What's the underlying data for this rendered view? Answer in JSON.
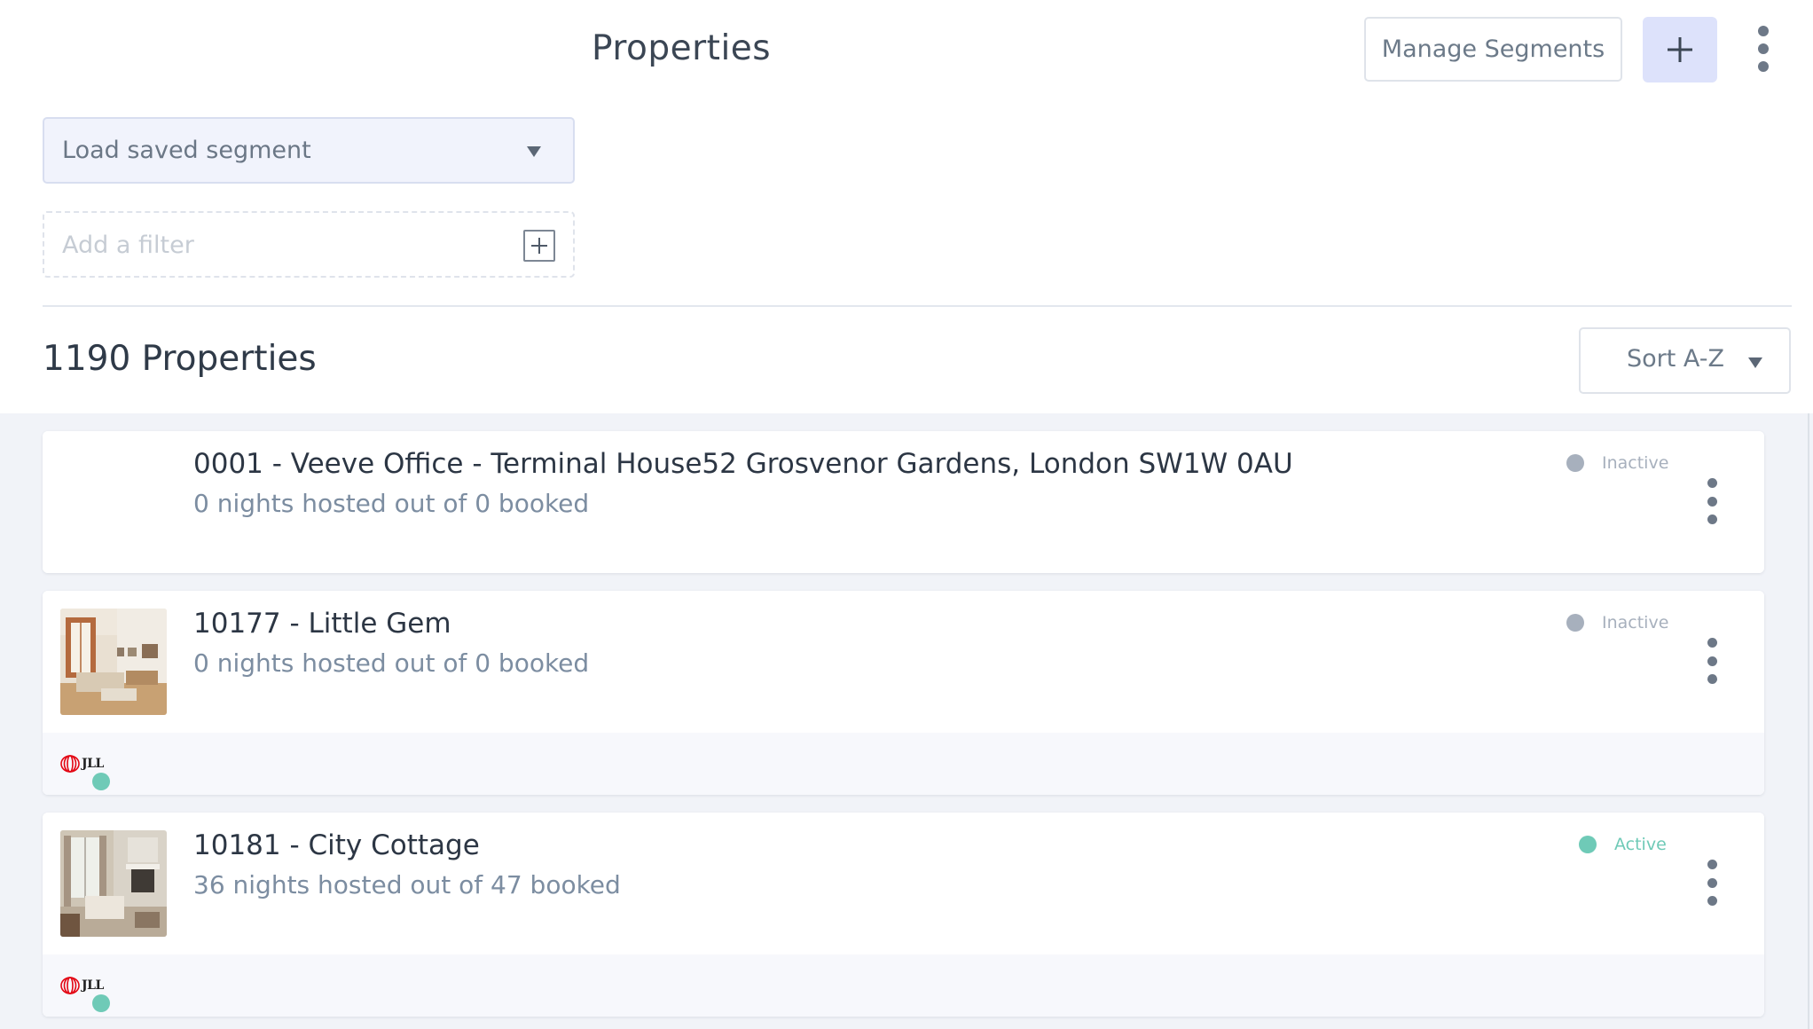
{
  "header": {
    "title": "Properties",
    "manage_segments_label": "Manage Segments",
    "add_icon": "plus-icon",
    "menu_icon": "vertical-dots-icon"
  },
  "filters": {
    "segment_placeholder": "Load saved segment",
    "filter_placeholder": "Add a filter",
    "filter_value": ""
  },
  "results": {
    "count_label": "1190 Properties",
    "sort_label": "Sort A-Z"
  },
  "colors": {
    "inactive": "#a7b0bd",
    "active": "#6fcab7",
    "accent": "#dde2fb",
    "jll_red": "#e30613"
  },
  "properties": [
    {
      "name": "0001 - Veeve Office - Terminal House52 Grosvenor Gardens, London SW1W 0AU",
      "nights": "0 nights hosted out of 0 booked",
      "status": "Inactive",
      "has_thumb": false,
      "partner_logo": ""
    },
    {
      "name": "10177 - Little Gem",
      "nights": "0 nights hosted out of 0 booked",
      "status": "Inactive",
      "has_thumb": true,
      "partner_logo": "JLL"
    },
    {
      "name": "10181 - City Cottage",
      "nights": "36 nights hosted out of 47 booked",
      "status": "Active",
      "has_thumb": true,
      "partner_logo": "JLL"
    }
  ]
}
